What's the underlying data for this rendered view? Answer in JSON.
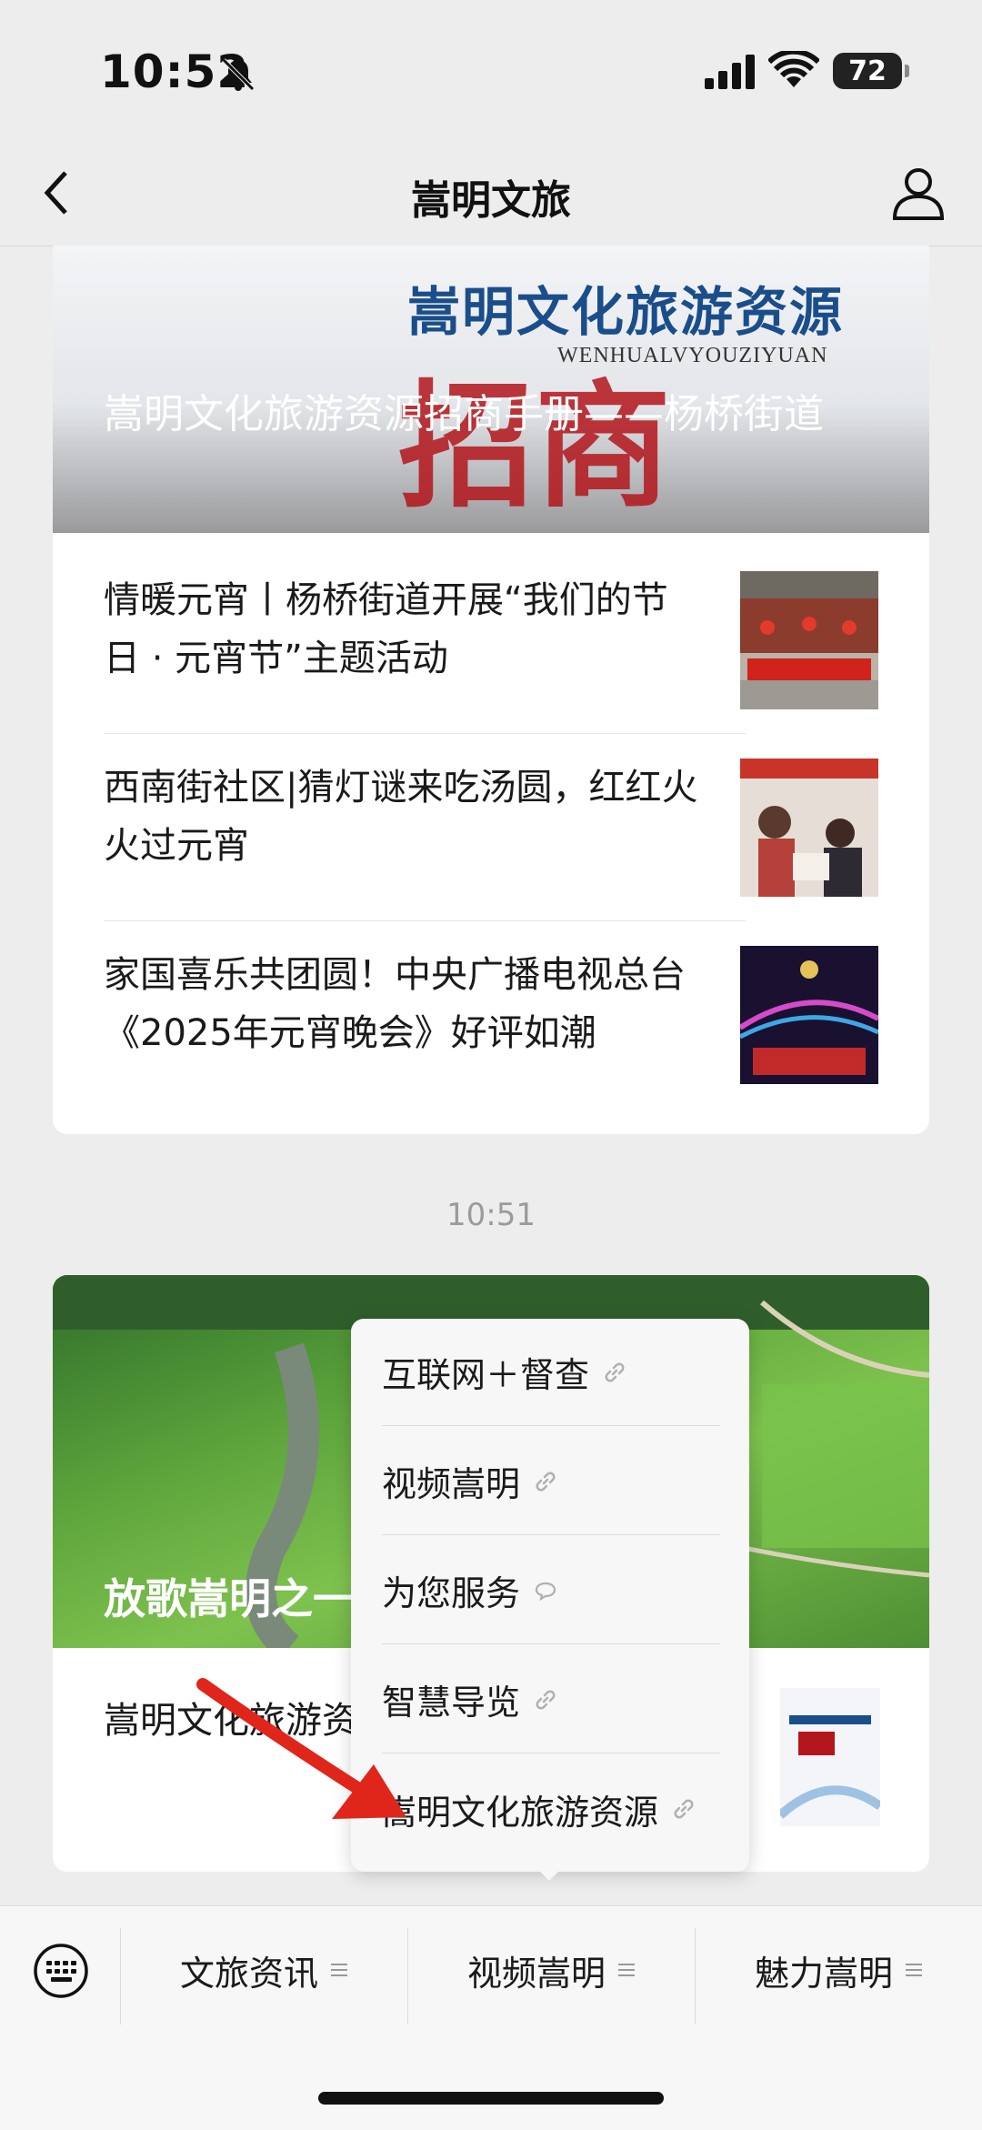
{
  "status_bar": {
    "time": "10:52",
    "battery": "72"
  },
  "nav": {
    "title": "嵩明文旅"
  },
  "card1": {
    "banner_heading": "嵩明文化旅游资源",
    "banner_subheading": "WENHUALVYOUZIYUAN",
    "banner_script": "招商",
    "banner_title": "嵩明文化旅游资源招商手册——杨桥街道",
    "items": [
      {
        "text": "情暖元宵丨杨桥街道开展“我们的节日 · 元宵节”主题活动"
      },
      {
        "text": "西南街社区|猜灯谜来吃汤圆，红红火火过元宵"
      },
      {
        "text": "家国喜乐共团圆！中央广播电视总台《2025年元宵晚会》好评如潮"
      }
    ]
  },
  "timestamp": "10:51",
  "card2": {
    "banner_title": "放歌嵩明之一",
    "text": "嵩明文化旅游资源招商手册——林镇"
  },
  "popup_menu": {
    "items": [
      {
        "label": "互联网＋督查",
        "icon": "link-icon"
      },
      {
        "label": "视频嵩明",
        "icon": "link-icon"
      },
      {
        "label": "为您服务",
        "icon": "chat-bubble-icon"
      },
      {
        "label": "智慧导览",
        "icon": "link-icon"
      },
      {
        "label": "嵩明文化旅游资源",
        "icon": "link-icon"
      }
    ]
  },
  "tab_bar": {
    "tabs": [
      {
        "label": "文旅资讯"
      },
      {
        "label": "视频嵩明"
      },
      {
        "label": "魅力嵩明"
      }
    ]
  },
  "colors": {
    "annotation_arrow": "#e0251b",
    "banner_heading": "#1a4e8a"
  }
}
